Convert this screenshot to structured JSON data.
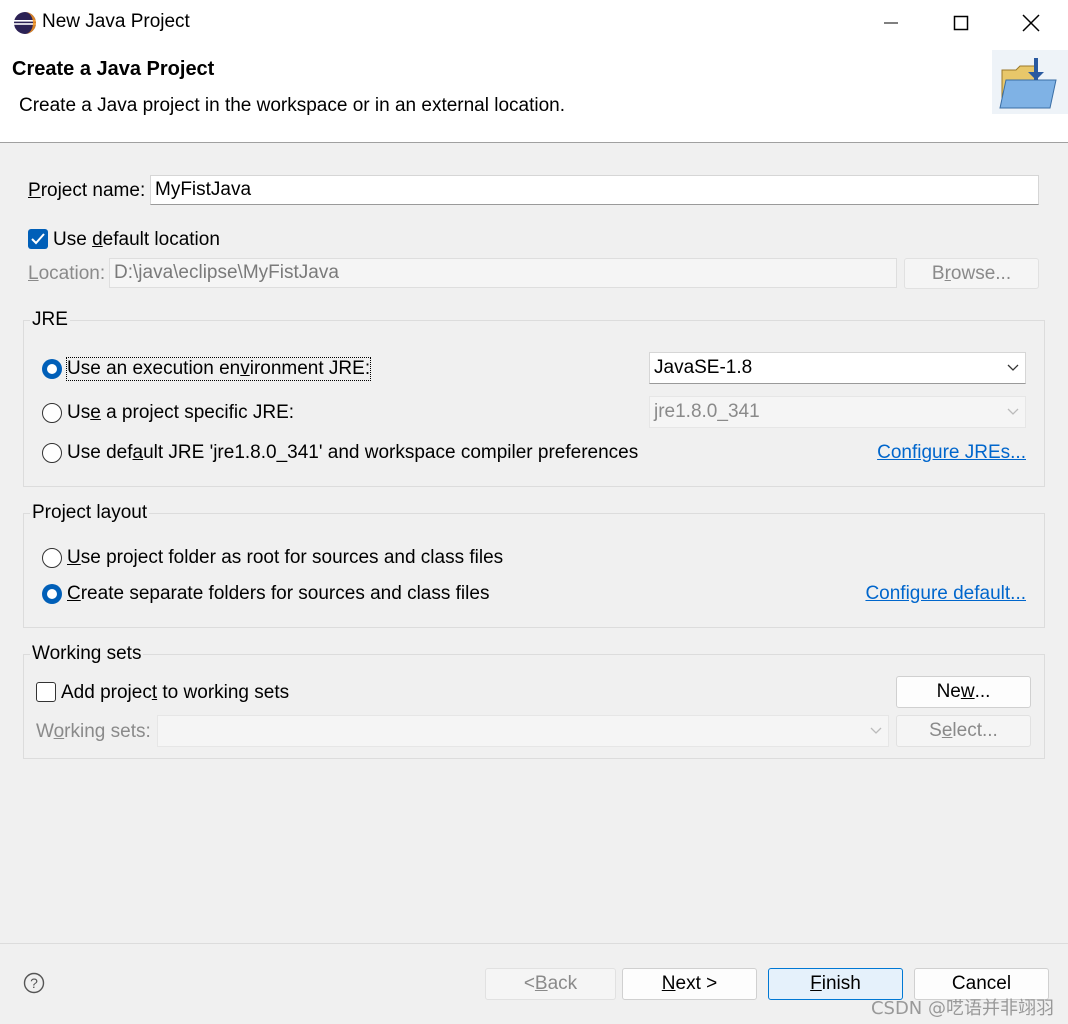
{
  "window": {
    "title": "New Java Project",
    "minimize_icon": "minimize-icon",
    "maximize_icon": "maximize-icon",
    "close_icon": "close-icon"
  },
  "banner": {
    "title": "Create a Java Project",
    "description": "Create a Java project in the workspace or in an external location.",
    "icon": "new-java-project-folder-icon"
  },
  "project_name": {
    "label_prefix": "P",
    "label_rest": "roject name:",
    "value": "MyFistJava"
  },
  "use_default_location": {
    "checked": true,
    "label_prefix": "Use ",
    "label_mnemonic": "d",
    "label_rest": "efault location"
  },
  "location": {
    "label_mnemonic": "L",
    "label_rest": "ocation:",
    "value": "D:\\java\\eclipse\\MyFistJava",
    "browse_prefix": "B",
    "browse_mnemonic": "r",
    "browse_rest": "owse..."
  },
  "jre": {
    "group_title": "JRE",
    "option1": {
      "selected": true,
      "pre": "Use an execution en",
      "mn": "v",
      "post": "ironment JRE:",
      "select_value": "JavaSE-1.8"
    },
    "option2": {
      "selected": false,
      "pre": "Us",
      "mn": "e",
      "post": " a project specific JRE:",
      "select_value": "jre1.8.0_341"
    },
    "option3": {
      "selected": false,
      "pre": "Use def",
      "mn": "a",
      "post": "ult JRE 'jre1.8.0_341' and workspace compiler preferences"
    },
    "configure_link": "Configure JREs..."
  },
  "project_layout": {
    "group_title": "Project layout",
    "option1": {
      "selected": false,
      "mn": "U",
      "post": "se project folder as root for sources and class files"
    },
    "option2": {
      "selected": true,
      "mn": "C",
      "post": "reate separate folders for sources and class files"
    },
    "configure_link": "Configure default..."
  },
  "working_sets": {
    "group_title": "Working sets",
    "add_checked": false,
    "add_pre": "Add projec",
    "add_mn": "t",
    "add_post": " to working sets",
    "new_pre": "Ne",
    "new_mn": "w",
    "new_post": "...",
    "label_pre": "W",
    "label_mn": "o",
    "label_post": "rking sets:",
    "select_pre": "S",
    "select_mn": "e",
    "select_post": "lect..."
  },
  "footer": {
    "help_icon": "help-icon",
    "back_pre": "< ",
    "back_mn": "B",
    "back_post": "ack",
    "next_mn": "N",
    "next_post": "ext >",
    "finish_mn": "F",
    "finish_post": "inish",
    "cancel": "Cancel"
  },
  "watermark": "CSDN @呓语并非翊羽",
  "colors": {
    "accent": "#005fb8",
    "link": "#0066cc",
    "background": "#f0f0f0"
  }
}
